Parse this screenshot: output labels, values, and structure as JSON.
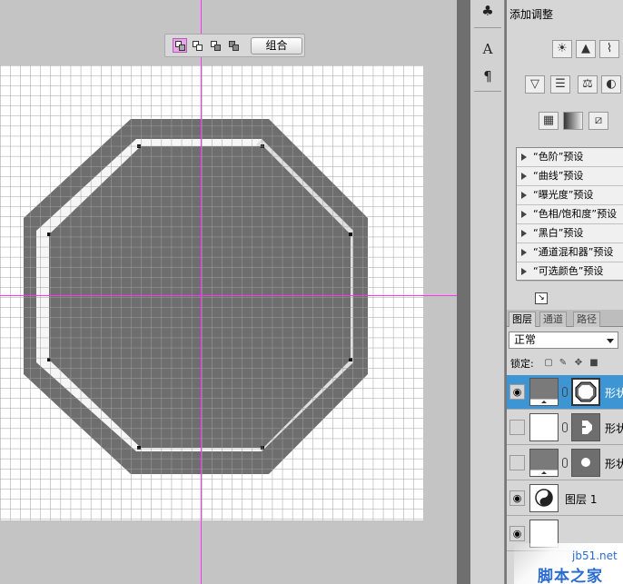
{
  "colors": {
    "workspace": "#c4c4c4",
    "canvas": "#ffffff",
    "grid": "#a0a0a0",
    "shape_fill": "#6e6e6e",
    "guide": "#ff33ff",
    "selection": "#3d95d3"
  },
  "combine_bar": {
    "mode_icons": [
      "add-to-shape-icon",
      "subtract-shape-icon",
      "intersect-shape-icon",
      "exclude-overlap-icon"
    ],
    "combine_label": "组合"
  },
  "dock": {
    "icons": [
      "clone-stamp-icon",
      "character-icon",
      "paragraph-icon"
    ]
  },
  "adjustments": {
    "title": "添加调整",
    "icon_rows": [
      [
        "brightness-icon",
        "levels-icon",
        "curves-icon"
      ],
      [
        "vibrance-icon",
        "hue-saturation-icon",
        "color-balance-icon"
      ],
      [
        "channel-mixer-icon",
        "gradient-map-icon",
        "threshold-icon"
      ]
    ],
    "presets": [
      "“色阶”预设",
      "“曲线”预设",
      "“曝光度”预设",
      "“色相/饱和度”预设",
      "“黑白”预设",
      "“通道混和器”预设",
      "“可选颜色”预设"
    ]
  },
  "layers": {
    "tabs": [
      "图层",
      "通道",
      "路径"
    ],
    "blend_mode": "正常",
    "lock_label": "锁定:",
    "rows": [
      {
        "name": "形状",
        "visible": true,
        "selected": true,
        "mask": "octagon"
      },
      {
        "name": "形状",
        "visible": false,
        "selected": false,
        "mask": "notch"
      },
      {
        "name": "形状",
        "visible": false,
        "selected": false,
        "mask": "circle"
      },
      {
        "name": "图层 1",
        "visible": true,
        "selected": false,
        "mask": "none"
      },
      {
        "name": "",
        "visible": true,
        "selected": false,
        "mask": "none"
      }
    ]
  },
  "watermark": {
    "url": "jb51.net",
    "text": "脚本之家"
  }
}
